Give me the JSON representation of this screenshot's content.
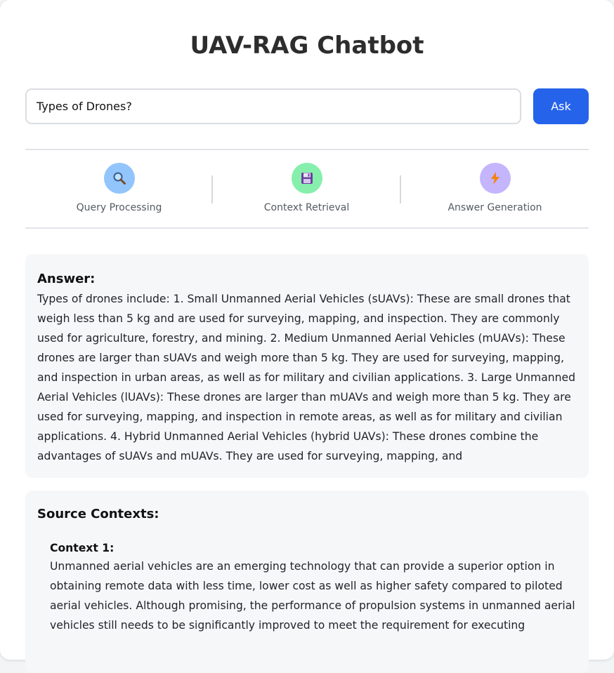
{
  "app": {
    "title": "UAV-RAG Chatbot"
  },
  "search": {
    "value": "Types of Drones?",
    "button_label": "Ask"
  },
  "pipeline": {
    "steps": [
      {
        "label": "Query Processing",
        "icon": "magnifier-icon",
        "color": "#93c5fd"
      },
      {
        "label": "Context Retrieval",
        "icon": "floppy-disk-icon",
        "color": "#86efac"
      },
      {
        "label": "Answer Generation",
        "icon": "lightning-icon",
        "color": "#c4b5fd"
      }
    ]
  },
  "answer": {
    "heading": "Answer:",
    "text": "Types of drones include: 1. Small Unmanned Aerial Vehicles (sUAVs): These are small drones that weigh less than 5 kg and are used for surveying, mapping, and inspection. They are commonly used for agriculture, forestry, and mining. 2. Medium Unmanned Aerial Vehicles (mUAVs): These drones are larger than sUAVs and weigh more than 5 kg. They are used for surveying, mapping, and inspection in urban areas, as well as for military and civilian applications. 3. Large Unmanned Aerial Vehicles (lUAVs): These drones are larger than mUAVs and weigh more than 5 kg. They are used for surveying, mapping, and inspection in remote areas, as well as for military and civilian applications. 4. Hybrid Unmanned Aerial Vehicles (hybrid UAVs): These drones combine the advantages of sUAVs and mUAVs. They are used for surveying, mapping, and"
  },
  "sources": {
    "heading": "Source Contexts:",
    "contexts": [
      {
        "title": "Context 1:",
        "text": "Unmanned aerial vehicles are an emerging technology that can provide a superior option in obtaining remote data with less time, lower cost as well as higher safety compared to piloted aerial vehicles. Although promising, the performance of propulsion systems in unmanned aerial vehicles still needs to be significantly improved to meet the requirement for executing"
      }
    ]
  }
}
